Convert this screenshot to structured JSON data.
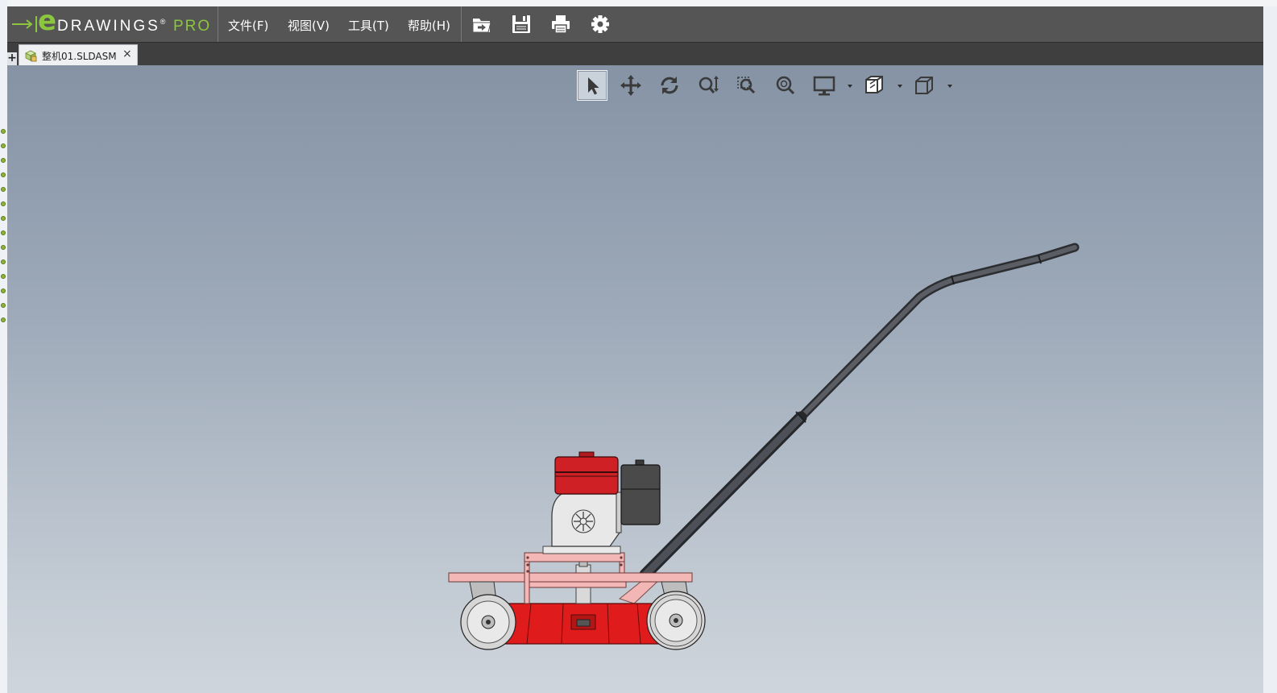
{
  "app": {
    "logo_e": "e",
    "logo_name": "DRAWINGS",
    "logo_reg": "®",
    "logo_suffix": "PRO",
    "brand_color": "#8cc63f"
  },
  "menu": [
    {
      "label": "文件(F)"
    },
    {
      "label": "视图(V)"
    },
    {
      "label": "工具(T)"
    },
    {
      "label": "帮助(H)"
    }
  ],
  "toolbar": {
    "icons": [
      "open-icon",
      "save-icon",
      "print-icon",
      "settings-icon"
    ]
  },
  "tabs": {
    "add_label": "+",
    "document": {
      "label": "整机01.SLDASM",
      "close": "×",
      "icon": "assembly-icon"
    }
  },
  "view_toolbar": {
    "tools": [
      {
        "name": "select-tool",
        "active": true
      },
      {
        "name": "pan-tool",
        "active": false
      },
      {
        "name": "rotate-tool",
        "active": false
      },
      {
        "name": "zoom-tool",
        "active": false
      },
      {
        "name": "zoom-area-tool",
        "active": false
      },
      {
        "name": "zoom-to-fit-tool",
        "active": false
      },
      {
        "name": "display-style-tool",
        "active": false,
        "dropdown": true
      },
      {
        "name": "section-tool",
        "active": false,
        "dropdown": true
      },
      {
        "name": "standard-views-tool",
        "active": false,
        "dropdown": true
      }
    ]
  },
  "model": {
    "description_name": "lawn-mower-assembly",
    "colors": {
      "frame": "#f3b7b5",
      "deck": "#e01b1b",
      "fuel_tank": "#cf2026",
      "air_filter": "#4a4a4a",
      "handle": "#4a4d52",
      "wheel": "#d9d9d9",
      "engine": "#e6e6e6"
    }
  }
}
